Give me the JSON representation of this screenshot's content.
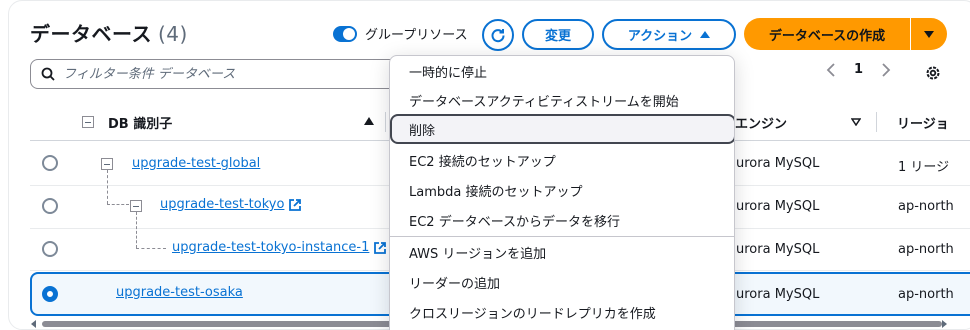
{
  "header": {
    "title": "データベース",
    "count": "(4)",
    "group_toggle_label": "グループリソース",
    "change_label": "変更",
    "actions_label": "アクション",
    "create_label": "データベースの作成"
  },
  "search": {
    "placeholder": "フィルター条件 データベース"
  },
  "pagination": {
    "current_page": "1"
  },
  "columns": {
    "db_id": "DB 識別子",
    "engine": "エンジン",
    "region": "リージョ"
  },
  "rows": [
    {
      "name": "upgrade-test-global",
      "engine": "urora MySQL",
      "region": "1 リージ"
    },
    {
      "name": "upgrade-test-tokyo",
      "engine": "urora MySQL",
      "region": "ap-north"
    },
    {
      "name": "upgrade-test-tokyo-instance-1",
      "engine": "urora MySQL",
      "region": "ap-north"
    },
    {
      "name": "upgrade-test-osaka",
      "engine": "urora MySQL",
      "region": "ap-north"
    }
  ],
  "menu": {
    "items": [
      "一時的に停止",
      "データベースアクティビティストリームを開始",
      "削除",
      "EC2 接続のセットアップ",
      "Lambda 接続のセットアップ",
      "EC2 データベースからデータを移行",
      "AWS リージョンを追加",
      "リーダーの追加",
      "クロスリージョンのリードレプリカを作成"
    ],
    "highlighted": "削除"
  },
  "colors": {
    "accent": "#0972d3",
    "primary_button": "#ff9900"
  },
  "icons": [
    "refresh-icon",
    "search-icon",
    "chevron-left-icon",
    "chevron-right-icon",
    "gear-icon",
    "external-link-icon",
    "sort-ascending-icon",
    "sort-descending-icon"
  ]
}
